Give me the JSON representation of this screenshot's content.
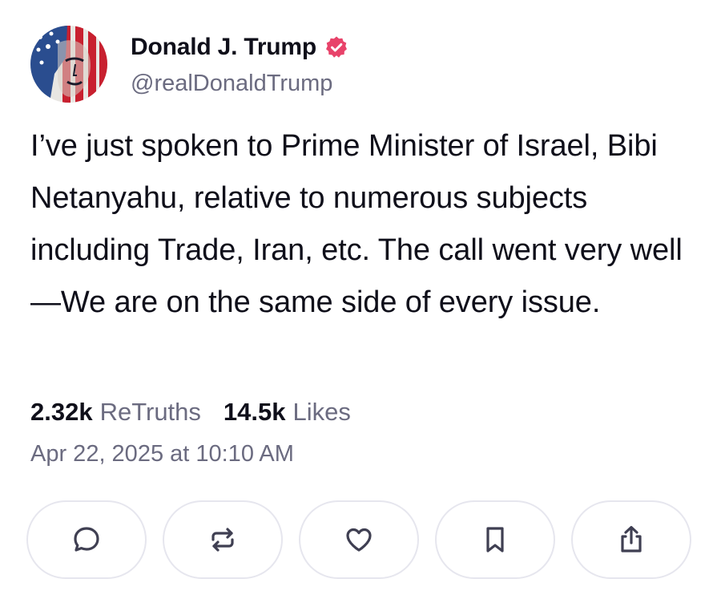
{
  "post": {
    "author": {
      "display_name": "Donald J. Trump",
      "handle": "@realDonaldTrump",
      "avatar_icon": "avatar-flag-portrait",
      "verified_icon": "verified-badge-icon",
      "verified_color": "#e8436a"
    },
    "text": "I’ve just spoken to Prime Minister of Israel, Bibi Netanyahu, relative to numerous subjects including Trade, Iran, etc. The call went very well—We are on the same side of every issue.",
    "stats": {
      "retruths_count": "2.32k",
      "retruths_label": "ReTruths",
      "likes_count": "14.5k",
      "likes_label": "Likes"
    },
    "timestamp": "Apr 22, 2025 at 10:10 AM"
  },
  "actions": [
    {
      "name": "reply",
      "icon": "comment-icon"
    },
    {
      "name": "retruth",
      "icon": "repost-icon"
    },
    {
      "name": "like",
      "icon": "heart-icon"
    },
    {
      "name": "bookmark",
      "icon": "bookmark-icon"
    },
    {
      "name": "share",
      "icon": "share-icon"
    }
  ],
  "colors": {
    "text_primary": "#0f0f1a",
    "text_secondary": "#6b6b80",
    "button_border": "#e6e6ee",
    "icon_color": "#3f3f52"
  }
}
